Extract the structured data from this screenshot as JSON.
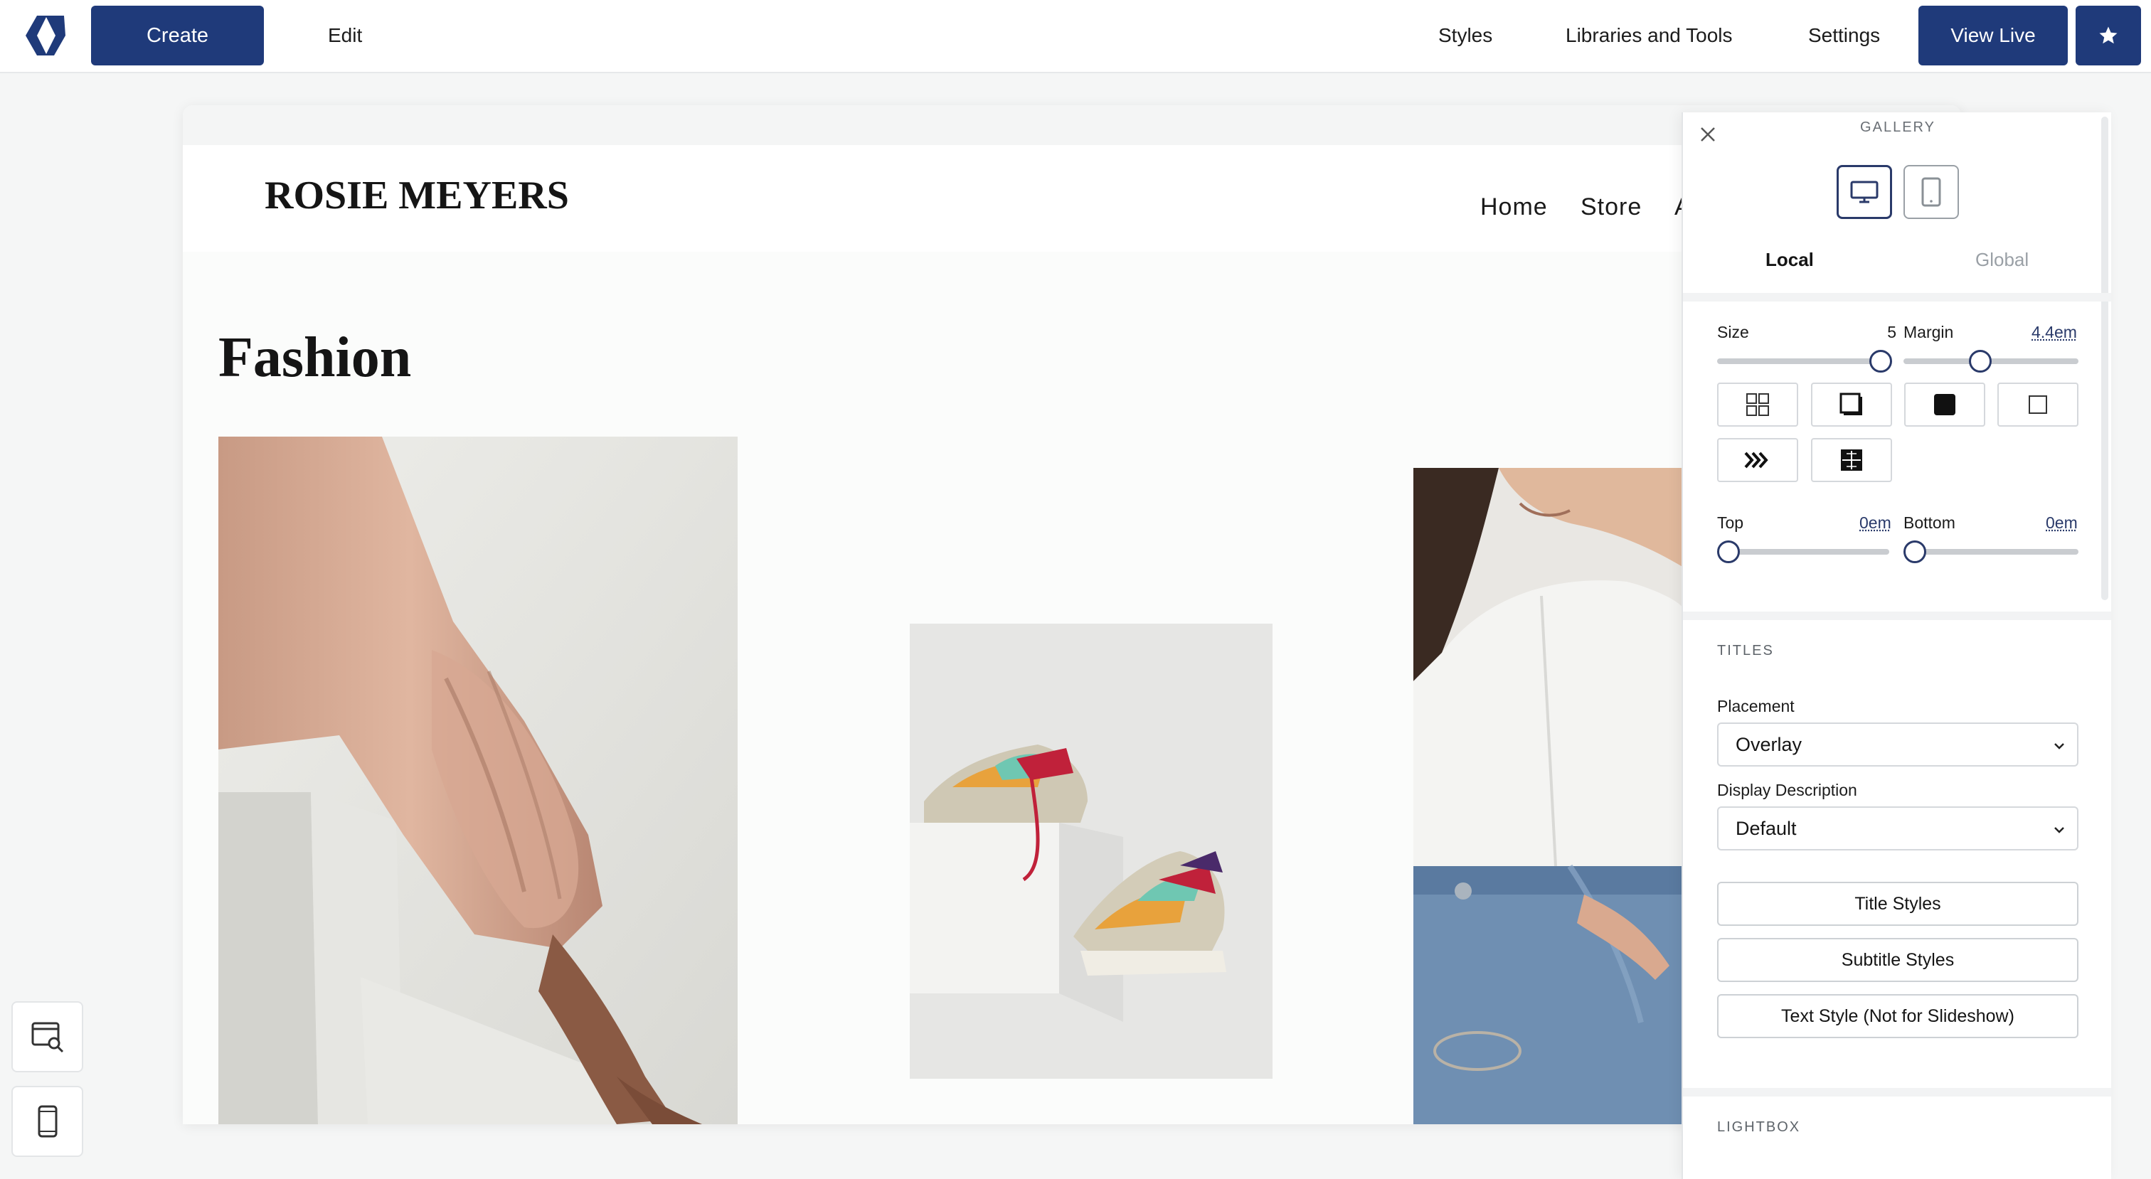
{
  "toolbar": {
    "create_label": "Create",
    "edit_label": "Edit",
    "styles_label": "Styles",
    "libraries_label": "Libraries and Tools",
    "settings_label": "Settings",
    "view_live_label": "View Live",
    "star_icon": "star-icon",
    "logo_icon": "logo-icon",
    "accent_color": "#1f3a7a"
  },
  "site": {
    "brand": "ROSIE MEYERS",
    "nav": [
      "Home",
      "Store",
      "A"
    ],
    "gallery_title": "Fashion",
    "photos": [
      {
        "subject": "peach-blouse-arm"
      },
      {
        "subject": "sneakers-on-block"
      },
      {
        "subject": "woman-white-shirt-jeans"
      }
    ]
  },
  "left_tools": [
    {
      "icon": "browser-search-icon"
    },
    {
      "icon": "mobile-device-icon"
    }
  ],
  "panel": {
    "title": "GALLERY",
    "close_icon": "close-icon",
    "devices": [
      {
        "icon": "desktop-icon",
        "active": true
      },
      {
        "icon": "tablet-icon",
        "active": false
      }
    ],
    "tabs": [
      {
        "label": "Local",
        "active": true
      },
      {
        "label": "Global",
        "active": false
      }
    ],
    "size": {
      "label": "Size",
      "value": "5"
    },
    "margin": {
      "label": "Margin",
      "value": "4.4em"
    },
    "layouts": [
      {
        "icon": "grid-layout-icon",
        "selected": false
      },
      {
        "icon": "shadow-box-layout-icon",
        "selected": false
      },
      {
        "icon": "filled-square-layout-icon",
        "selected": false
      },
      {
        "icon": "empty-square-layout-icon",
        "selected": false
      },
      {
        "icon": "slideshow-arrows-icon",
        "selected": false
      },
      {
        "icon": "mosaic-layout-icon",
        "selected": false
      }
    ],
    "top": {
      "label": "Top",
      "value": "0em"
    },
    "bottom": {
      "label": "Bottom",
      "value": "0em"
    },
    "titles": {
      "heading": "TITLES",
      "placement_label": "Placement",
      "placement_value": "Overlay",
      "description_label": "Display Description",
      "description_value": "Default",
      "title_styles_label": "Title Styles",
      "subtitle_styles_label": "Subtitle Styles",
      "text_style_label": "Text Style (Not for Slideshow)"
    },
    "lightbox": {
      "heading": "LIGHTBOX"
    }
  }
}
